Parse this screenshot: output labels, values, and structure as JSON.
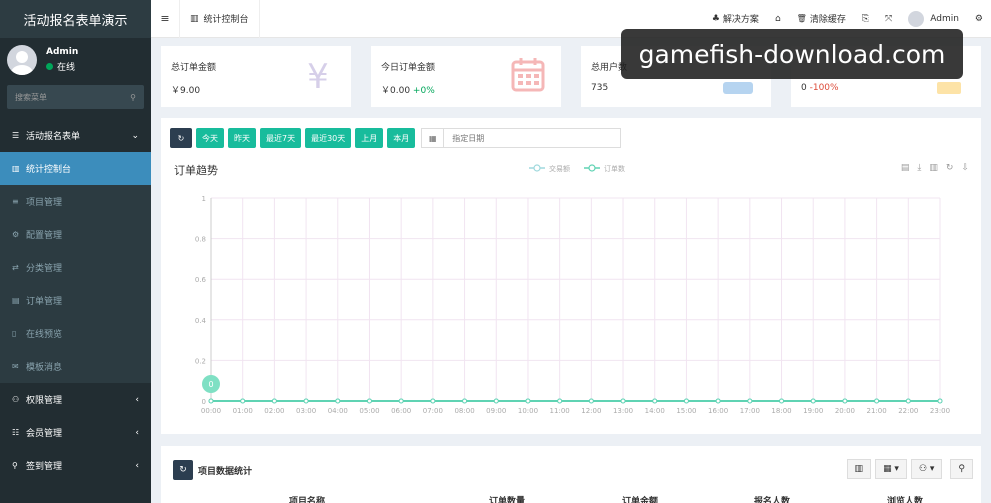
{
  "sidebar": {
    "brand": "活动报名表单演示",
    "user": {
      "name": "Admin",
      "status": "在线"
    },
    "search_placeholder": "搜索菜单",
    "items": [
      {
        "icon": "☰",
        "label": "活动报名表单",
        "arrow": "⌄"
      },
      {
        "icon": "▥",
        "label": "统计控制台"
      },
      {
        "icon": "≡",
        "label": "项目管理"
      },
      {
        "icon": "⚙",
        "label": "配置管理"
      },
      {
        "icon": "⇄",
        "label": "分类管理"
      },
      {
        "icon": "▤",
        "label": "订单管理"
      },
      {
        "icon": "▯",
        "label": "在线预览"
      },
      {
        "icon": "✉",
        "label": "模板消息"
      },
      {
        "icon": "⚇",
        "label": "权限管理",
        "arrow": "‹"
      },
      {
        "icon": "☷",
        "label": "会员管理",
        "arrow": "‹"
      },
      {
        "icon": "⚲",
        "label": "签到管理",
        "arrow": "‹"
      }
    ]
  },
  "navbar": {
    "toggle_icon": "≡",
    "tab_icon": "▥",
    "tab_label": "统计控制台",
    "links": [
      {
        "icon": "♣",
        "label": "解决方案"
      },
      {
        "icon": "⌂",
        "label": ""
      },
      {
        "icon": "🗑",
        "label": "清除缓存"
      },
      {
        "icon": "⎘",
        "label": ""
      },
      {
        "icon": "⤧",
        "label": ""
      }
    ],
    "user_name": "Admin",
    "settings_icon": "⚙"
  },
  "cards": [
    {
      "title": "总订单金额",
      "value": "￥9.00",
      "change": "",
      "change_color": ""
    },
    {
      "title": "今日订单金额",
      "value": "￥0.00",
      "change": "+0%",
      "change_color": "green"
    },
    {
      "title": "总用户数",
      "value": "735",
      "change": "",
      "change_color": ""
    },
    {
      "title": "",
      "value": "0",
      "change": "-100%",
      "change_color": "red"
    }
  ],
  "watermark": "gamefish-download.com",
  "toolbar": {
    "refresh_icon": "↻",
    "buttons": [
      "今天",
      "昨天",
      "最近7天",
      "最近30天",
      "上月",
      "本月"
    ],
    "date_placeholder": "指定日期",
    "calendar_icon": "▦"
  },
  "chart_title": "订单趋势",
  "chart_tools": [
    "▤",
    "⤓",
    "▥",
    "↻",
    "⇩"
  ],
  "chart_data": {
    "type": "line",
    "x": [
      "00:00",
      "01:00",
      "02:00",
      "03:00",
      "04:00",
      "05:00",
      "06:00",
      "07:00",
      "08:00",
      "09:00",
      "10:00",
      "11:00",
      "12:00",
      "13:00",
      "14:00",
      "15:00",
      "16:00",
      "17:00",
      "18:00",
      "19:00",
      "20:00",
      "21:00",
      "22:00",
      "23:00"
    ],
    "series": [
      {
        "name": "交易额",
        "values": [
          0,
          0,
          0,
          0,
          0,
          0,
          0,
          0,
          0,
          0,
          0,
          0,
          0,
          0,
          0,
          0,
          0,
          0,
          0,
          0,
          0,
          0,
          0,
          0
        ]
      },
      {
        "name": "订单数",
        "values": [
          0,
          0,
          0,
          0,
          0,
          0,
          0,
          0,
          0,
          0,
          0,
          0,
          0,
          0,
          0,
          0,
          0,
          0,
          0,
          0,
          0,
          0,
          0,
          0
        ]
      }
    ],
    "yticks": [
      "0",
      "0.2",
      "0.4",
      "0.6",
      "0.8",
      "1"
    ],
    "ylim": [
      0,
      1
    ],
    "marker_label": "0",
    "colors": [
      "#9fd9dd",
      "#5fd3b3"
    ]
  },
  "bottom": {
    "refresh_icon": "↻",
    "title": "项目数据统计",
    "tools": [
      "▥",
      "▦ ▾",
      "⚇ ▾",
      "⚲"
    ],
    "columns": [
      "项目名称",
      "订单数量",
      "订单金额",
      "报名人数",
      "浏览人数"
    ]
  }
}
